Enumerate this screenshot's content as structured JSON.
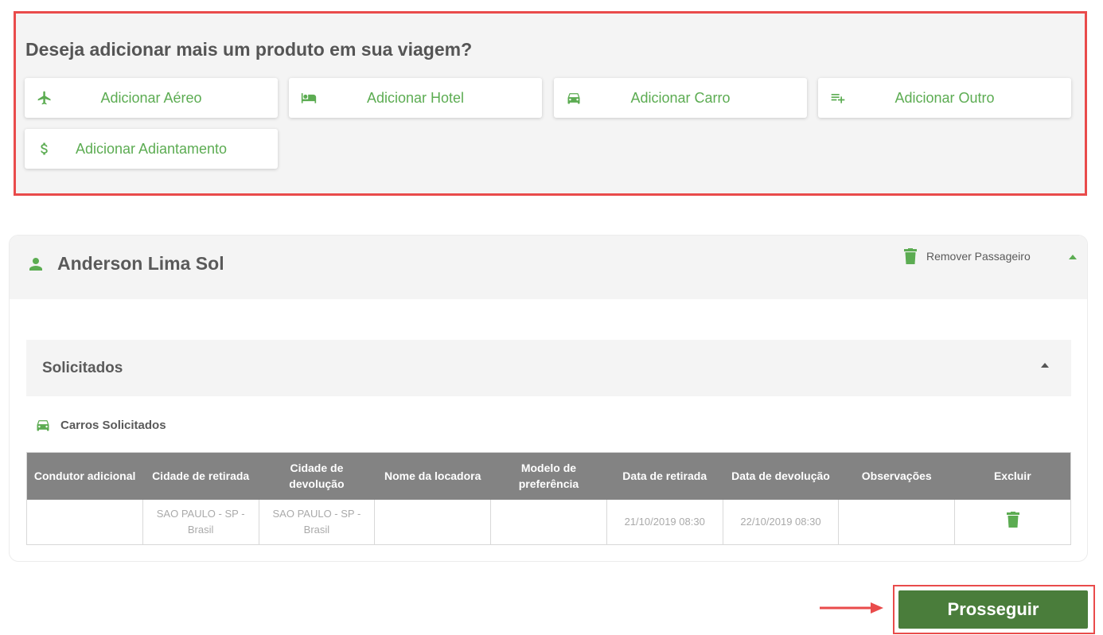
{
  "add_section": {
    "title": "Deseja adicionar mais um produto em sua viagem?",
    "buttons": [
      {
        "label": "Adicionar Aéreo",
        "icon": "airplane-icon"
      },
      {
        "label": "Adicionar Hotel",
        "icon": "bed-icon"
      },
      {
        "label": "Adicionar Carro",
        "icon": "car-icon"
      },
      {
        "label": "Adicionar Outro",
        "icon": "playlist-add-icon"
      },
      {
        "label": "Adicionar Adiantamento",
        "icon": "dollar-icon"
      }
    ]
  },
  "passenger": {
    "name": "Anderson Lima Sol",
    "remove_label": "Remover Passageiro"
  },
  "solicitados": {
    "label": "Solicitados",
    "cars_title": "Carros Solicitados",
    "table": {
      "headers": [
        "Condutor adicional",
        "Cidade de retirada",
        "Cidade de devolução",
        "Nome da locadora",
        "Modelo de preferência",
        "Data de retirada",
        "Data de devolução",
        "Observações",
        "Excluir"
      ],
      "rows": [
        [
          "",
          "SAO PAULO - SP - Brasil",
          "SAO PAULO - SP - Brasil",
          "",
          "",
          "21/10/2019 08:30",
          "22/10/2019 08:30",
          ""
        ]
      ]
    }
  },
  "proceed_label": "Prosseguir",
  "colors": {
    "accent_green": "#5cac52",
    "button_green": "#4a7d3b",
    "highlight_red": "#e94b4b",
    "table_header": "#838383"
  }
}
